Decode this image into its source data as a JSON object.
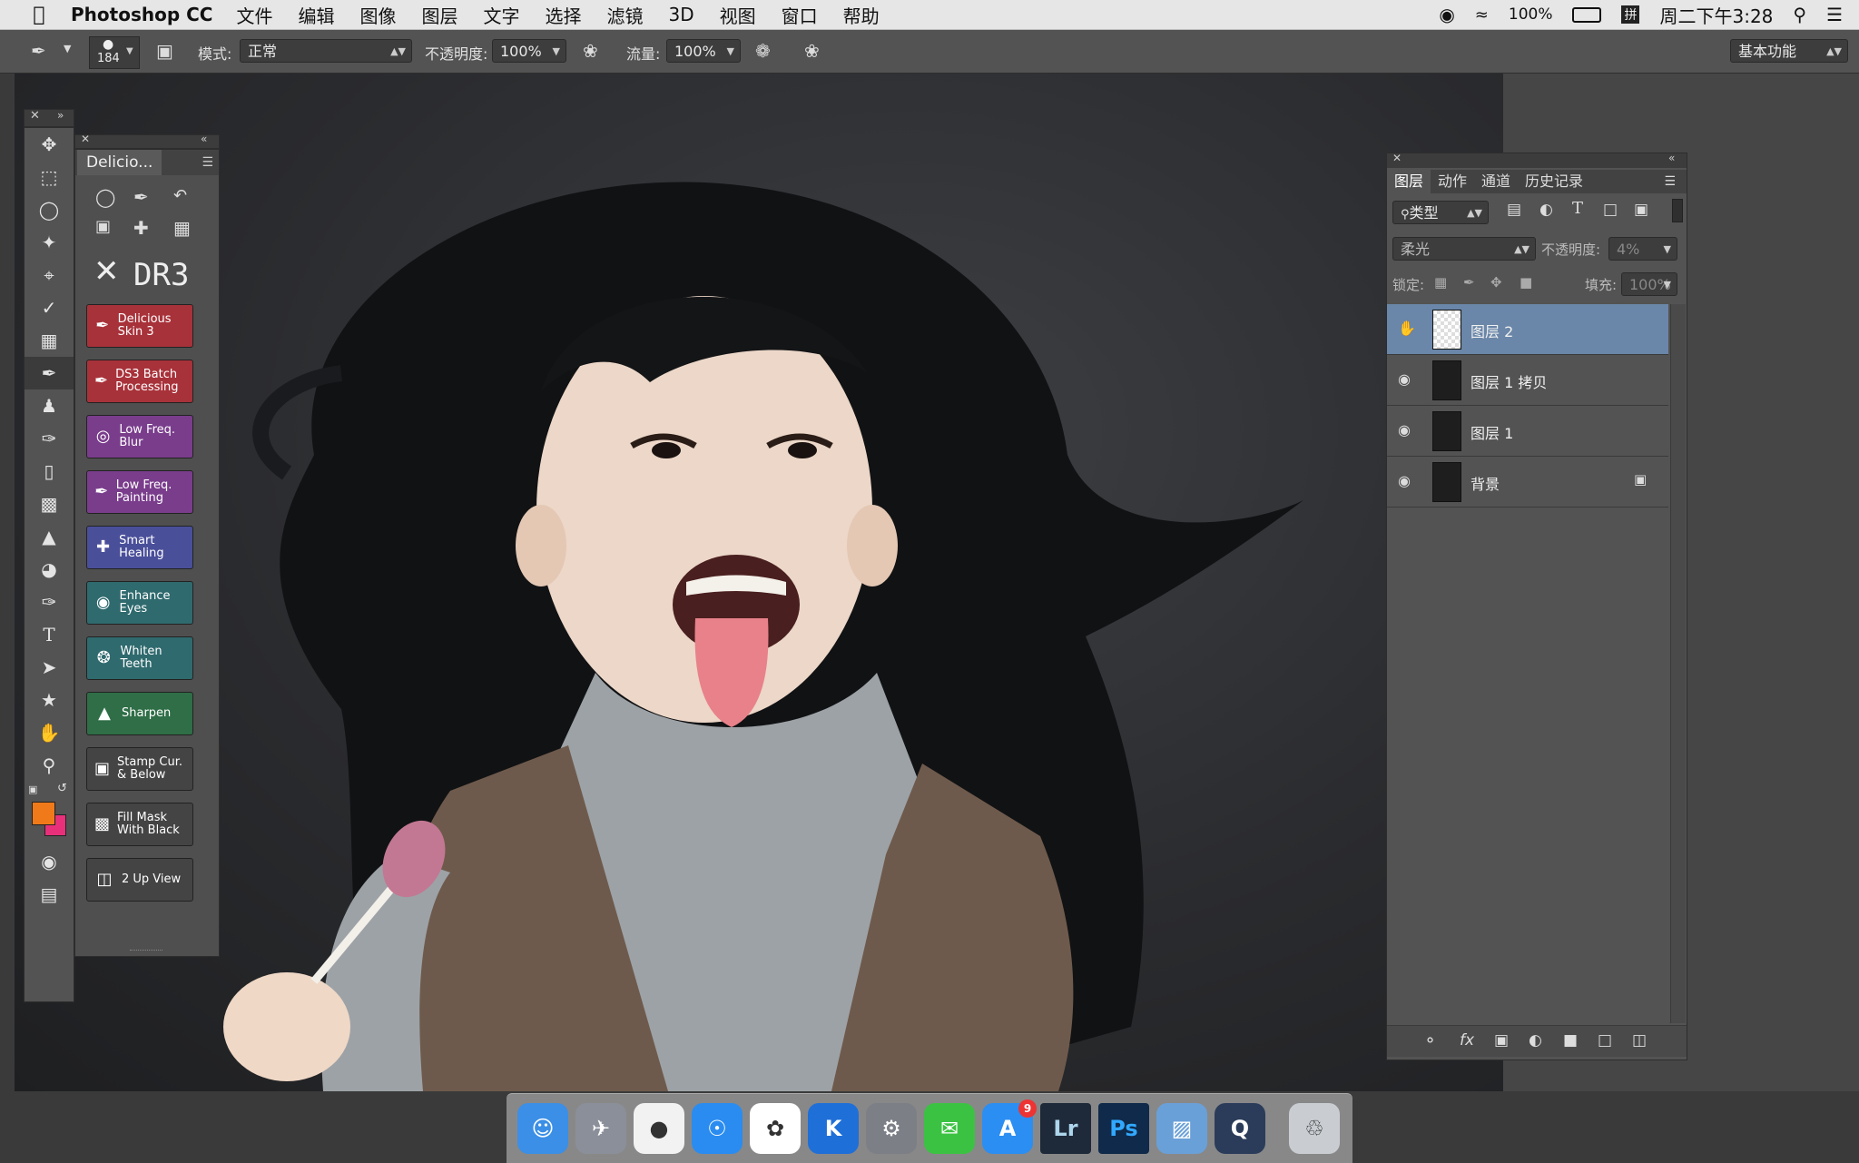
{
  "menubar": {
    "app": "Photoshop CC",
    "items": [
      "文件",
      "编辑",
      "图像",
      "图层",
      "文字",
      "选择",
      "滤镜",
      "3D",
      "视图",
      "窗口",
      "帮助"
    ],
    "battery": "100%",
    "clock": "周二下午3:28"
  },
  "options": {
    "brush_size": "184",
    "mode_label": "模式:",
    "mode_value": "正常",
    "opacity_label": "不透明度:",
    "opacity_value": "100%",
    "flow_label": "流量:",
    "flow_value": "100%",
    "workspace": "基本功能"
  },
  "plugin": {
    "tab": "Delicio...",
    "logo": "DR3",
    "buttons": [
      {
        "label": "Delicious Skin 3",
        "color": "#a8323a",
        "icon": "brush-icon"
      },
      {
        "label": "DS3 Batch Processing",
        "color": "#a8323a",
        "icon": "brush-icon"
      },
      {
        "label": "Low Freq. Blur",
        "color": "#7a3d8c",
        "icon": "blur-icon"
      },
      {
        "label": "Low Freq. Painting",
        "color": "#7a3d8c",
        "icon": "brush-icon"
      },
      {
        "label": "Smart Healing",
        "color": "#4a4f9a",
        "icon": "bandage-icon"
      },
      {
        "label": "Enhance Eyes",
        "color": "#2f6a6e",
        "icon": "eye-icon"
      },
      {
        "label": "Whiten Teeth",
        "color": "#2f6a6e",
        "icon": "tooth-icon"
      },
      {
        "label": "Sharpen",
        "color": "#2f6e46",
        "icon": "triangle-icon"
      },
      {
        "label": "Stamp Cur. & Below",
        "color": "#444444",
        "icon": "stamp-icon"
      },
      {
        "label": "Fill Mask With Black",
        "color": "#444444",
        "icon": "mask-icon"
      },
      {
        "label": "2 Up View",
        "color": "#444444",
        "icon": "split-icon"
      }
    ]
  },
  "layers": {
    "tabs": [
      "图层",
      "动作",
      "通道",
      "历史记录"
    ],
    "filter": "类型",
    "blend": "柔光",
    "opacity_label": "不透明度:",
    "opacity_value": "4%",
    "lock_label": "锁定:",
    "fill_label": "填充:",
    "fill_value": "100%",
    "rows": [
      {
        "name": "图层 2",
        "selected": true
      },
      {
        "name": "图层 1 拷贝",
        "selected": false
      },
      {
        "name": "图层 1",
        "selected": false
      },
      {
        "name": "背景",
        "selected": false,
        "locked": true
      }
    ]
  },
  "dock": {
    "badge": "9",
    "apps": [
      "Finder",
      "Launchpad",
      "QQ",
      "Safari",
      "Photos",
      "Keynote",
      "System Preferences",
      "WeChat",
      "App Store",
      "Lr",
      "Ps",
      "Preview",
      "QuickTime",
      "Trash"
    ]
  },
  "colors": {
    "foreground": "#f07a1a",
    "background": "#e8307a",
    "selection": "#6a86a8"
  }
}
